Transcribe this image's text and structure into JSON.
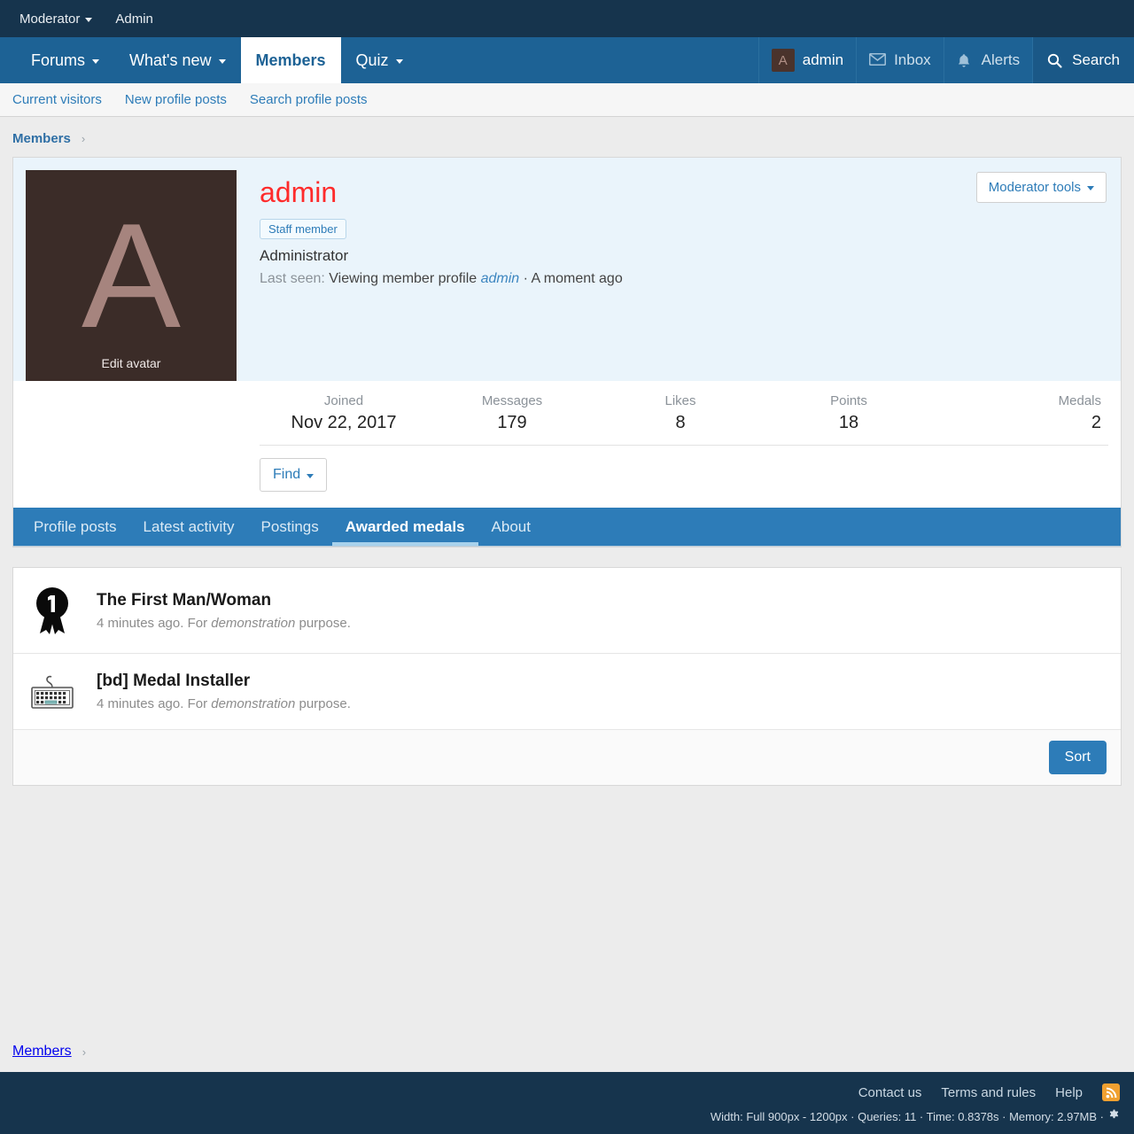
{
  "topbar": {
    "items": [
      {
        "label": "Moderator",
        "has_caret": true,
        "name": "topbar-moderator"
      },
      {
        "label": "Admin",
        "has_caret": false,
        "name": "topbar-admin"
      }
    ]
  },
  "nav": {
    "items": [
      {
        "label": "Forums",
        "has_caret": true,
        "active": false
      },
      {
        "label": "What's new",
        "has_caret": true,
        "active": false
      },
      {
        "label": "Members",
        "has_caret": false,
        "active": true
      },
      {
        "label": "Quiz",
        "has_caret": true,
        "active": false
      }
    ],
    "account": {
      "username": "admin",
      "avatar_letter": "A",
      "inbox": "Inbox",
      "alerts": "Alerts",
      "search": "Search"
    }
  },
  "subnav": {
    "items": [
      "Current visitors",
      "New profile posts",
      "Search profile posts"
    ]
  },
  "breadcrumb": {
    "label": "Members",
    "separator": "›"
  },
  "profile": {
    "avatar_letter": "A",
    "edit_avatar": "Edit avatar",
    "username": "admin",
    "staff_badge": "Staff member",
    "title": "Administrator",
    "last_seen_label": "Last seen:",
    "last_seen_activity": "Viewing member profile",
    "last_seen_link": "admin",
    "last_seen_sep": "·",
    "last_seen_time": "A moment ago",
    "moderator_tools": "Moderator tools",
    "find_button": "Find",
    "stats": [
      {
        "key": "Joined",
        "value": "Nov 22, 2017"
      },
      {
        "key": "Messages",
        "value": "179"
      },
      {
        "key": "Likes",
        "value": "8"
      },
      {
        "key": "Points",
        "value": "18"
      },
      {
        "key": "Medals",
        "value": "2"
      }
    ],
    "tabs": [
      {
        "label": "Profile posts",
        "active": false
      },
      {
        "label": "Latest activity",
        "active": false
      },
      {
        "label": "Postings",
        "active": false
      },
      {
        "label": "Awarded medals",
        "active": true
      },
      {
        "label": "About",
        "active": false
      }
    ]
  },
  "medals": {
    "items": [
      {
        "icon": "ribbon-medal-icon",
        "title": "The First Man/Woman",
        "time": "4 minutes ago.",
        "desc_pre": "For",
        "desc_em": "demonstration",
        "desc_post": "purpose."
      },
      {
        "icon": "keyboard-icon",
        "title": "[bd] Medal Installer",
        "time": "4 minutes ago.",
        "desc_pre": "For",
        "desc_em": "demonstration",
        "desc_post": "purpose."
      }
    ],
    "sort_button": "Sort"
  },
  "footer": {
    "links": [
      "Contact us",
      "Terms and rules",
      "Help"
    ],
    "rss": "rss-icon",
    "stats_text": "Width: Full 900px - 1200px · Queries: 11 · Time: 0.8378s · Memory: 2.97MB ·",
    "gear": "gear-icon"
  },
  "colors": {
    "topbar": "#16344d",
    "navbar": "#1d6295",
    "tabs": "#2d7cb8",
    "accent_link": "#2d7cb8",
    "username": "#fe2b2b",
    "avatar_bg": "#3b2c28",
    "avatar_fg": "#a6847e",
    "rss": "#f0a030"
  }
}
